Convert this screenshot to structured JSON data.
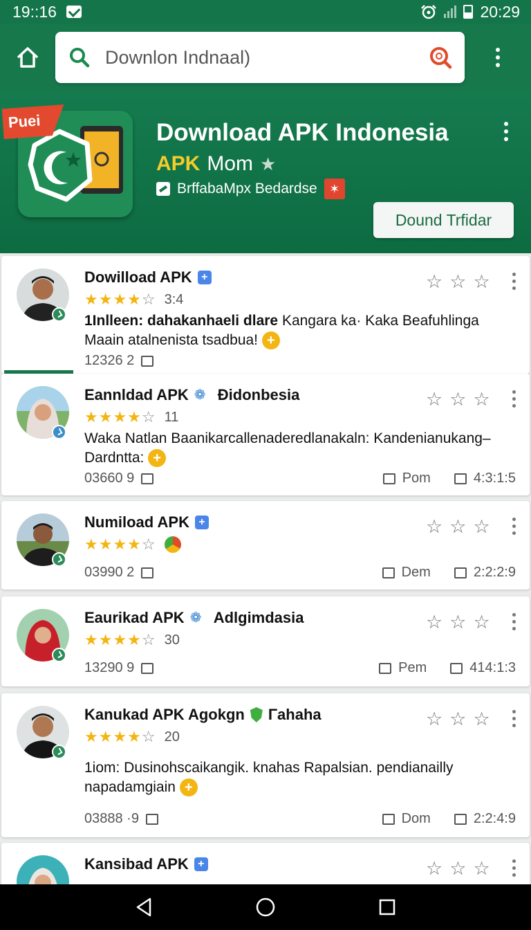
{
  "status_bar": {
    "time": "19::16",
    "clock": "20:29"
  },
  "search": {
    "value": "Downlon Indnaal)"
  },
  "hero": {
    "badge": "Puei",
    "title": "Download APK Indonesia",
    "sub_apk": "APK",
    "sub_text": "Mom",
    "developer": "BrffabaMpx Bedardse",
    "button": "Dound Trfidar"
  },
  "cards": [
    {
      "name": "Dowilload APK",
      "extra": "",
      "rating": "3:4",
      "desc_bold": "1Inlleen: dahakanhaeli dlare",
      "desc_rest": " Kangara ka· Kaka Beafuhlinga  Maain atalnenista tsadbua!",
      "count": "12326  2",
      "right_label": "",
      "right_value": ""
    },
    {
      "name": "Eannldad APK",
      "extra": "Đidonbesia",
      "rating": "11",
      "desc_bold": "",
      "desc_rest": "Waka Natlan Baanikarcallenaderedlanakaln: Kandenianukang–Dardntta:",
      "count": "03660  9",
      "right_label": "Pom",
      "right_value": "4:3:1:5"
    },
    {
      "name": "Numiload APK",
      "extra": "",
      "rating": "",
      "desc_bold": "",
      "desc_rest": "",
      "count": "03990  2",
      "right_label": "Dem",
      "right_value": "2:2:2:9"
    },
    {
      "name": "Eaurikad APK",
      "extra": "Adlgimdasia",
      "rating": "30",
      "desc_bold": "",
      "desc_rest": "",
      "count": "13290  9",
      "right_label": "Pem",
      "right_value": "414:1:3"
    },
    {
      "name": "Kanukad APK Agokgn",
      "extra": "Γahaha",
      "rating": "20",
      "desc_bold": "",
      "desc_rest": "1iom: Dusinohscaikangik. knahas Rapalsian. pendianailly napadamgiain",
      "count": "03888 ·9",
      "right_label": "Dom",
      "right_value": "2:2:4:9"
    },
    {
      "name": "Kansibad APK",
      "extra": "",
      "rating": "",
      "desc_bold": "",
      "desc_rest": "",
      "count": "",
      "right_label": "",
      "right_value": ""
    }
  ],
  "colors": {
    "primary": "#17784c",
    "accent": "#f3b511",
    "badge": "#e2492e"
  }
}
